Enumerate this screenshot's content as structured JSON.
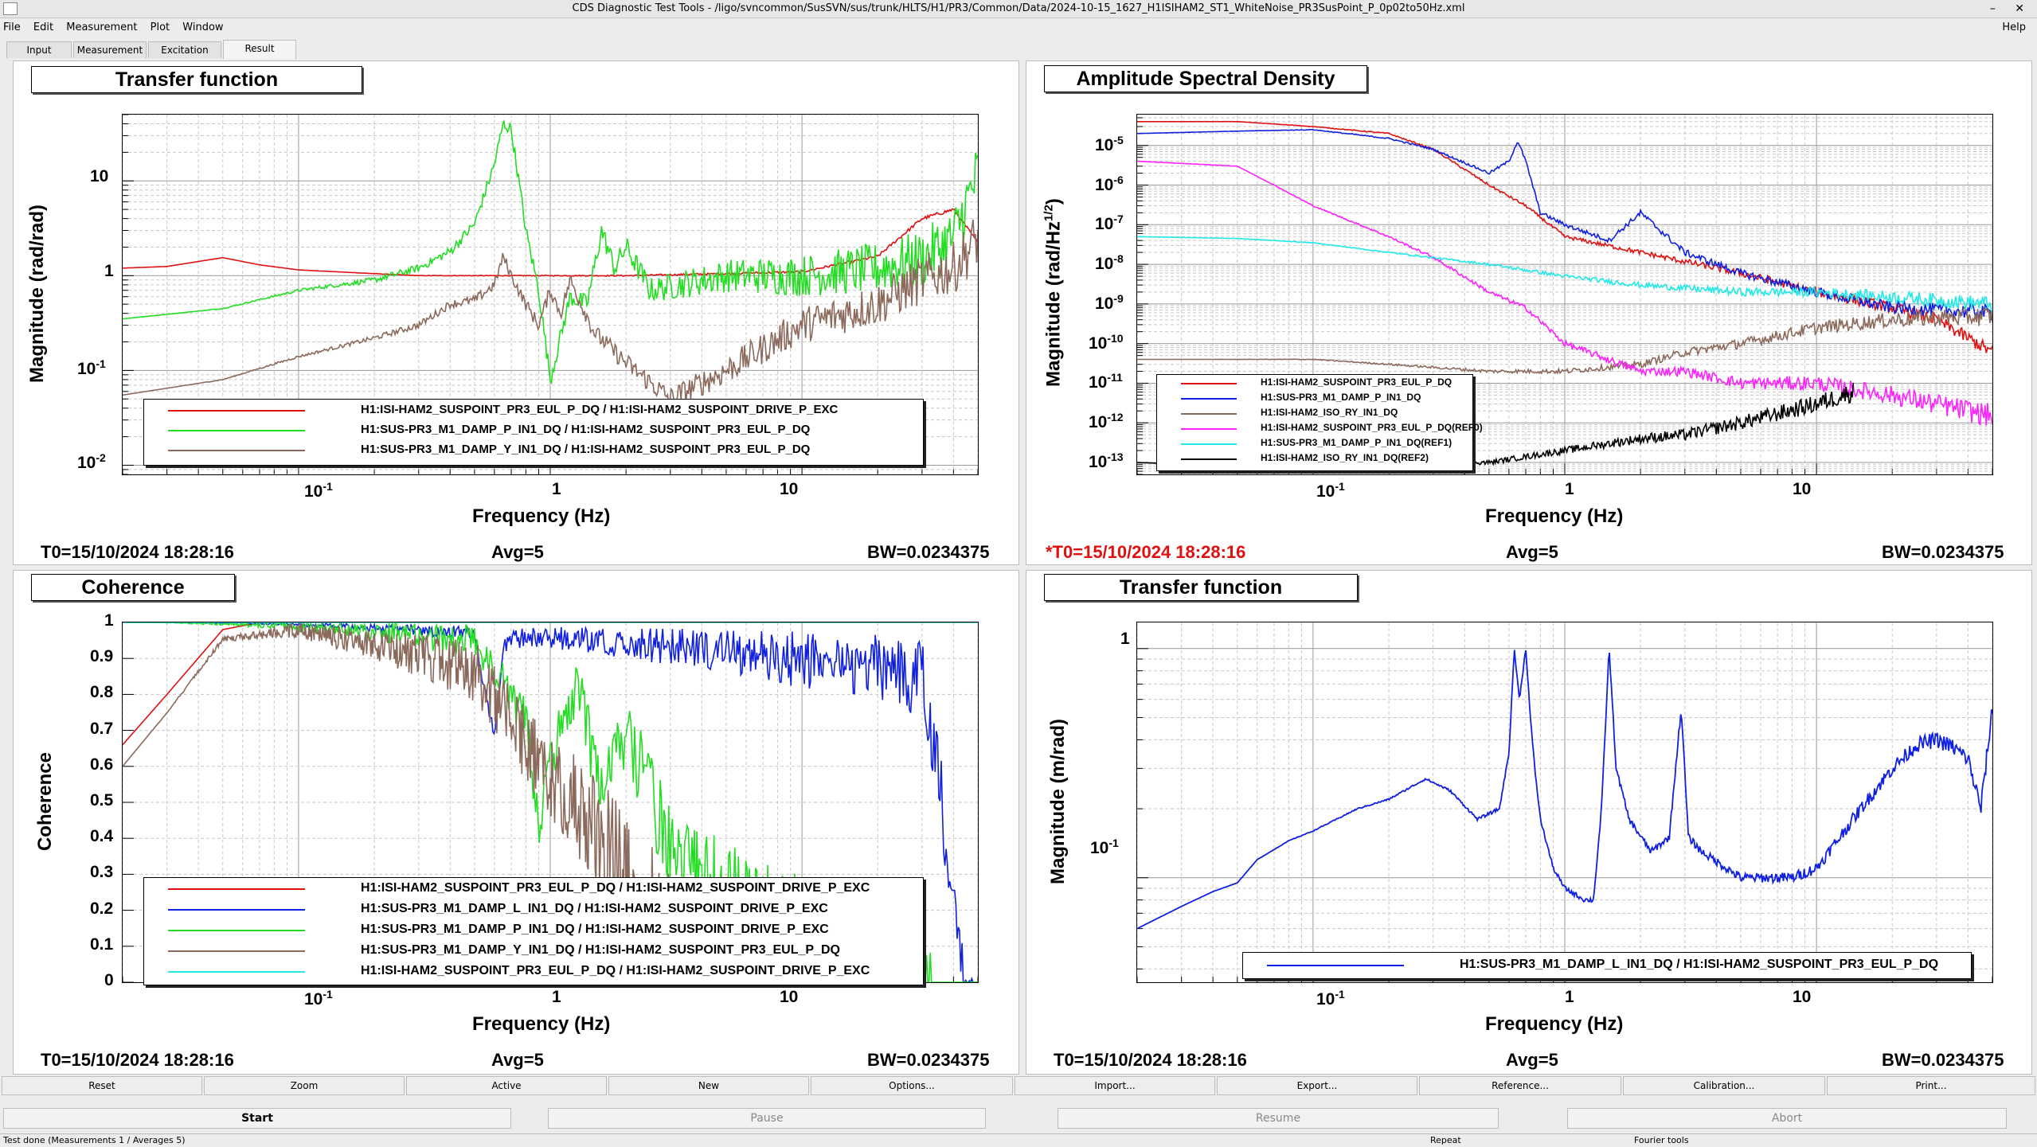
{
  "window": {
    "title": "CDS Diagnostic Test Tools - /ligo/svncommon/SusSVN/sus/trunk/HLTS/H1/PR3/Common/Data/2024-10-15_1627_H1ISIHAM2_ST1_WhiteNoise_PR3SusPoint_P_0p02to50Hz.xml",
    "controls": "– ✕"
  },
  "menu": {
    "file": "File",
    "edit": "Edit",
    "measurement": "Measurement",
    "plot": "Plot",
    "window": "Window",
    "help": "Help"
  },
  "tabs": [
    "Input",
    "Measurement",
    "Excitation",
    "Result"
  ],
  "panels": {
    "tl": {
      "title": "Transfer function",
      "ylabel": "Magnitude (rad/rad)",
      "xlabel": "Frequency (Hz)",
      "t0": "T0=15/10/2024 18:28:16",
      "avg": "Avg=5",
      "bw": "BW=0.0234375",
      "yticks": [
        "10",
        "1",
        "10",
        "10"
      ],
      "ytick_exp": [
        "",
        "",
        "-1",
        "-2"
      ],
      "legend": [
        {
          "label": "H1:ISI-HAM2_SUSPOINT_PR3_EUL_P_DQ / H1:ISI-HAM2_SUSPOINT_DRIVE_P_EXC",
          "color": "#e01010"
        },
        {
          "label": "H1:SUS-PR3_M1_DAMP_P_IN1_DQ / H1:ISI-HAM2_SUSPOINT_PR3_EUL_P_DQ",
          "color": "#22dd22"
        },
        {
          "label": "H1:SUS-PR3_M1_DAMP_Y_IN1_DQ / H1:ISI-HAM2_SUSPOINT_PR3_EUL_P_DQ",
          "color": "#8b6a5c"
        }
      ]
    },
    "tr": {
      "title": "Amplitude Spectral Density",
      "ylabel": "Magnitude (rad/Hz",
      "ylabel_sup": "1/2",
      "ylabel_end": ")",
      "xlabel": "Frequency (Hz)",
      "t0": "*T0=15/10/2024 18:28:16",
      "avg": "Avg=5",
      "bw": "BW=0.0234375",
      "ytick_exp": [
        "-5",
        "-6",
        "-7",
        "-8",
        "-9",
        "-10",
        "-11",
        "-12",
        "-13"
      ],
      "ytick_base": "10",
      "legend": [
        {
          "label": "H1:ISI-HAM2_SUSPOINT_PR3_EUL_P_DQ",
          "color": "#e01010"
        },
        {
          "label": "H1:SUS-PR3_M1_DAMP_P_IN1_DQ",
          "color": "#1020e0"
        },
        {
          "label": "H1:ISI-HAM2_ISO_RY_IN1_DQ",
          "color": "#8b6a5c"
        },
        {
          "label": "H1:ISI-HAM2_SUSPOINT_PR3_EUL_P_DQ(REF0)",
          "color": "#ff20ff"
        },
        {
          "label": "H1:SUS-PR3_M1_DAMP_P_IN1_DQ(REF1)",
          "color": "#22e8e8"
        },
        {
          "label": "H1:ISI-HAM2_ISO_RY_IN1_DQ(REF2)",
          "color": "#000000"
        }
      ]
    },
    "bl": {
      "title": "Coherence",
      "ylabel": "Coherence",
      "xlabel": "Frequency (Hz)",
      "t0": "T0=15/10/2024 18:28:16",
      "avg": "Avg=5",
      "bw": "BW=0.0234375",
      "yticks": [
        "1",
        "0.9",
        "0.8",
        "0.7",
        "0.6",
        "0.5",
        "0.4",
        "0.3",
        "0.2",
        "0.1",
        "0"
      ],
      "legend": [
        {
          "label": "H1:ISI-HAM2_SUSPOINT_PR3_EUL_P_DQ / H1:ISI-HAM2_SUSPOINT_DRIVE_P_EXC",
          "color": "#e01010"
        },
        {
          "label": "H1:SUS-PR3_M1_DAMP_L_IN1_DQ / H1:ISI-HAM2_SUSPOINT_DRIVE_P_EXC",
          "color": "#1020e0"
        },
        {
          "label": "H1:SUS-PR3_M1_DAMP_P_IN1_DQ / H1:ISI-HAM2_SUSPOINT_DRIVE_P_EXC",
          "color": "#22dd22"
        },
        {
          "label": "H1:SUS-PR3_M1_DAMP_Y_IN1_DQ / H1:ISI-HAM2_SUSPOINT_PR3_EUL_P_DQ",
          "color": "#8b6a5c"
        },
        {
          "label": "H1:ISI-HAM2_SUSPOINT_PR3_EUL_P_DQ / H1:ISI-HAM2_SUSPOINT_DRIVE_P_EXC",
          "color": "#22e8e8"
        }
      ]
    },
    "br": {
      "title": "Transfer function",
      "ylabel": "Magnitude (m/rad)",
      "xlabel": "Frequency (Hz)",
      "t0": "T0=15/10/2024 18:28:16",
      "avg": "Avg=5",
      "bw": "BW=0.0234375",
      "yticks": [
        "1",
        "10"
      ],
      "ytick_exp": [
        "",
        "-1"
      ],
      "legend": [
        {
          "label": "H1:SUS-PR3_M1_DAMP_L_IN1_DQ / H1:ISI-HAM2_SUSPOINT_PR3_EUL_P_DQ",
          "color": "#1020e0"
        }
      ]
    }
  },
  "xticks": {
    "base": "10",
    "exp": "-1",
    "one": "1",
    "ten": "10"
  },
  "toolbar1": [
    "Reset",
    "Zoom",
    "Active",
    "New",
    "Options...",
    "Import...",
    "Export...",
    "Reference...",
    "Calibration...",
    "Print..."
  ],
  "toolbar2": {
    "start": "Start",
    "pause": "Pause",
    "resume": "Resume",
    "abort": "Abort"
  },
  "status": {
    "left": "Test done (Measurements 1 / Averages 5)",
    "mid": "Repeat",
    "right": "Fourier tools"
  },
  "chart_data": [
    {
      "type": "line",
      "title": "Transfer function",
      "xlabel": "Frequency (Hz)",
      "ylabel": "Magnitude (rad/rad)",
      "xscale": "log",
      "yscale": "log",
      "xlim": [
        0.02,
        50
      ],
      "ylim": [
        0.008,
        50
      ],
      "grid": true,
      "legend": "bottom",
      "series": [
        {
          "name": "H1:ISI-HAM2_SUSPOINT_PR3_EUL_P_DQ / H1:ISI-HAM2_SUSPOINT_DRIVE_P_EXC",
          "color": "#e01010",
          "x": [
            0.02,
            0.03,
            0.05,
            0.07,
            0.1,
            0.2,
            0.3,
            0.5,
            1,
            2,
            5,
            10,
            20,
            30,
            40,
            50
          ],
          "y": [
            1.2,
            1.25,
            1.55,
            1.3,
            1.15,
            1.05,
            1.0,
            1.0,
            1.0,
            1.0,
            1.05,
            1.1,
            1.6,
            4.0,
            5.0,
            2.2
          ]
        },
        {
          "name": "H1:SUS-PR3_M1_DAMP_P_IN1_DQ / H1:ISI-HAM2_SUSPOINT_PR3_EUL_P_DQ",
          "color": "#22dd22",
          "x": [
            0.02,
            0.05,
            0.1,
            0.2,
            0.3,
            0.4,
            0.5,
            0.6,
            0.65,
            0.7,
            0.75,
            0.8,
            0.9,
            1.0,
            1.2,
            1.4,
            1.6,
            1.8,
            2.0,
            2.5,
            5,
            10,
            20,
            30,
            40,
            50
          ],
          "y": [
            0.35,
            0.45,
            0.7,
            0.9,
            1.2,
            1.8,
            3.5,
            15,
            40,
            35,
            10,
            3,
            0.7,
            0.08,
            0.6,
            0.5,
            3,
            1.2,
            2,
            0.7,
            1.0,
            1.0,
            1.2,
            1.5,
            2.5,
            12
          ]
        },
        {
          "name": "H1:SUS-PR3_M1_DAMP_Y_IN1_DQ / H1:ISI-HAM2_SUSPOINT_PR3_EUL_P_DQ",
          "color": "#8b6a5c",
          "x": [
            0.02,
            0.05,
            0.1,
            0.2,
            0.3,
            0.4,
            0.5,
            0.6,
            0.65,
            0.7,
            0.8,
            0.9,
            1.0,
            1.1,
            1.2,
            1.5,
            2,
            3,
            5,
            10,
            20,
            30,
            40,
            50
          ],
          "y": [
            0.055,
            0.08,
            0.14,
            0.22,
            0.3,
            0.5,
            0.55,
            0.8,
            1.6,
            1.0,
            0.5,
            0.3,
            0.7,
            0.4,
            0.9,
            0.25,
            0.12,
            0.05,
            0.1,
            0.3,
            0.5,
            0.9,
            1.2,
            2.5
          ]
        }
      ]
    },
    {
      "type": "line",
      "title": "Amplitude Spectral Density",
      "xlabel": "Frequency (Hz)",
      "ylabel": "Magnitude (rad/Hz^1/2)",
      "xscale": "log",
      "yscale": "log",
      "xlim": [
        0.02,
        50
      ],
      "ylim": [
        5e-14,
        6e-05
      ],
      "grid": true,
      "legend": "bottom-left",
      "series": [
        {
          "name": "H1:ISI-HAM2_SUSPOINT_PR3_EUL_P_DQ",
          "color": "#e01010",
          "x": [
            0.02,
            0.05,
            0.1,
            0.2,
            0.3,
            0.5,
            0.7,
            1,
            2,
            5,
            10,
            20,
            30,
            50
          ],
          "y": [
            4e-05,
            4e-05,
            3e-05,
            2e-05,
            8e-06,
            1e-06,
            3e-07,
            5e-08,
            2e-08,
            6e-09,
            2e-09,
            8e-10,
            4e-10,
            6e-11
          ]
        },
        {
          "name": "H1:SUS-PR3_M1_DAMP_P_IN1_DQ",
          "color": "#1020e0",
          "x": [
            0.02,
            0.05,
            0.1,
            0.2,
            0.3,
            0.5,
            0.6,
            0.65,
            0.7,
            0.8,
            1,
            1.5,
            2,
            3,
            5,
            10,
            20,
            50
          ],
          "y": [
            2e-05,
            2.3e-05,
            2.5e-05,
            1.5e-05,
            8e-06,
            2e-06,
            4e-06,
            1.3e-05,
            4e-06,
            2e-07,
            1e-07,
            4e-08,
            2e-07,
            2e-08,
            6e-09,
            2e-09,
            8e-10,
            6e-10
          ]
        },
        {
          "name": "H1:ISI-HAM2_ISO_RY_IN1_DQ",
          "color": "#8b6a5c",
          "x": [
            0.02,
            0.05,
            0.1,
            0.2,
            0.5,
            1,
            2,
            3,
            5,
            10,
            20,
            50
          ],
          "y": [
            4e-11,
            4e-11,
            4e-11,
            3e-11,
            2e-11,
            2e-11,
            3e-11,
            6e-11,
            1e-10,
            2.5e-10,
            4e-10,
            5e-10
          ]
        },
        {
          "name": "H1:ISI-HAM2_SUSPOINT_PR3_EUL_P_DQ(REF0)",
          "color": "#ff20ff",
          "x": [
            0.02,
            0.05,
            0.07,
            0.1,
            0.2,
            0.3,
            0.5,
            0.7,
            1,
            2,
            3,
            5,
            10,
            20,
            50
          ],
          "y": [
            4e-06,
            3e-06,
            1e-06,
            3e-07,
            5e-08,
            1.5e-08,
            2e-09,
            8e-10,
            1e-10,
            2e-11,
            2e-11,
            1e-11,
            1e-11,
            5e-12,
            1.5e-12
          ]
        },
        {
          "name": "H1:SUS-PR3_M1_DAMP_P_IN1_DQ(REF1)",
          "color": "#22e8e8",
          "x": [
            0.02,
            0.05,
            0.1,
            0.2,
            0.5,
            1,
            2,
            5,
            10,
            20,
            50
          ],
          "y": [
            5e-08,
            4.5e-08,
            3.5e-08,
            2e-08,
            1e-08,
            5e-09,
            3e-09,
            2e-09,
            2e-09,
            1.5e-09,
            1e-09
          ]
        },
        {
          "name": "H1:ISI-HAM2_ISO_RY_IN1_DQ(REF2)",
          "color": "#000000",
          "x": [
            0.02,
            0.05,
            0.1,
            0.2,
            0.5,
            1,
            2,
            3,
            5,
            10,
            14
          ],
          "y": [
            1e-13,
            8e-14,
            6e-14,
            1e-13,
            1e-13,
            2e-13,
            4e-13,
            5e-13,
            1e-12,
            3e-12,
            6e-12
          ]
        }
      ]
    },
    {
      "type": "line",
      "title": "Coherence",
      "xlabel": "Frequency (Hz)",
      "ylabel": "Coherence",
      "xscale": "log",
      "yscale": "linear",
      "xlim": [
        0.02,
        50
      ],
      "ylim": [
        0,
        1
      ],
      "grid": true,
      "legend": "bottom",
      "series": [
        {
          "name": "H1:ISI-HAM2_SUSPOINT_PR3_EUL_P_DQ / H1:ISI-HAM2_SUSPOINT_DRIVE_P_EXC",
          "color": "#e01010",
          "x": [
            0.02,
            0.03,
            0.05,
            0.07,
            0.1,
            1,
            10,
            50
          ],
          "y": [
            0.66,
            0.8,
            0.98,
            1.0,
            1.0,
            1.0,
            1.0,
            1.0
          ]
        },
        {
          "name": "H1:SUS-PR3_M1_DAMP_L_IN1_DQ / H1:ISI-HAM2_SUSPOINT_DRIVE_P_EXC",
          "color": "#1020e0",
          "x": [
            0.02,
            0.1,
            0.5,
            0.6,
            0.65,
            0.7,
            1,
            5,
            20,
            30,
            35,
            40,
            45,
            50
          ],
          "y": [
            1.0,
            1.0,
            0.99,
            0.7,
            0.95,
            0.98,
            0.99,
            0.98,
            0.97,
            0.95,
            0.7,
            0.3,
            0.05,
            0.02
          ]
        },
        {
          "name": "H1:SUS-PR3_M1_DAMP_P_IN1_DQ / H1:ISI-HAM2_SUSPOINT_DRIVE_P_EXC",
          "color": "#22dd22",
          "x": [
            0.02,
            0.1,
            0.5,
            0.8,
            0.9,
            1,
            1.3,
            1.6,
            2,
            3,
            5,
            10,
            20,
            30,
            50
          ],
          "y": [
            1.0,
            1.0,
            1.0,
            0.8,
            0.5,
            0.7,
            0.9,
            0.6,
            0.8,
            0.5,
            0.4,
            0.3,
            0.2,
            0.1,
            0.02
          ]
        },
        {
          "name": "H1:SUS-PR3_M1_DAMP_Y_IN1_DQ / H1:ISI-HAM2_SUSPOINT_PR3_EUL_P_DQ",
          "color": "#8b6a5c",
          "x": [
            0.02,
            0.03,
            0.05,
            0.1,
            0.5,
            1,
            2,
            3,
            5
          ],
          "y": [
            0.6,
            0.75,
            0.96,
            1.0,
            0.95,
            0.7,
            0.5,
            0.3,
            0.1
          ]
        },
        {
          "name": "H1:ISI-HAM2_SUSPOINT_PR3_EUL_P_DQ / H1:ISI-HAM2_SUSPOINT_DRIVE_P_EXC",
          "color": "#22e8e8",
          "x": [
            0.02,
            0.1,
            1,
            10,
            50
          ],
          "y": [
            1.0,
            1.0,
            1.0,
            1.0,
            1.0
          ]
        }
      ]
    },
    {
      "type": "line",
      "title": "Transfer function",
      "xlabel": "Frequency (Hz)",
      "ylabel": "Magnitude (m/rad)",
      "xscale": "log",
      "yscale": "log",
      "xlim": [
        0.02,
        50
      ],
      "ylim": [
        0.035,
        1.3
      ],
      "grid": true,
      "legend": "bottom-right",
      "series": [
        {
          "name": "H1:SUS-PR3_M1_DAMP_L_IN1_DQ / H1:ISI-HAM2_SUSPOINT_PR3_EUL_P_DQ",
          "color": "#1020e0",
          "x": [
            0.02,
            0.03,
            0.04,
            0.05,
            0.06,
            0.08,
            0.1,
            0.15,
            0.2,
            0.28,
            0.35,
            0.45,
            0.55,
            0.6,
            0.63,
            0.66,
            0.7,
            0.73,
            0.76,
            0.8,
            0.9,
            1.0,
            1.2,
            1.3,
            1.4,
            1.5,
            1.6,
            1.8,
            2.2,
            2.6,
            2.9,
            3.1,
            3.5,
            5,
            8,
            10,
            15,
            20,
            25,
            30,
            35,
            40,
            45,
            50
          ],
          "y": [
            0.06,
            0.075,
            0.087,
            0.095,
            0.12,
            0.145,
            0.16,
            0.2,
            0.22,
            0.27,
            0.24,
            0.18,
            0.2,
            0.35,
            1.0,
            0.6,
            1.0,
            0.5,
            0.3,
            0.18,
            0.11,
            0.09,
            0.08,
            0.08,
            0.2,
            1.0,
            0.3,
            0.18,
            0.13,
            0.15,
            0.55,
            0.15,
            0.13,
            0.1,
            0.1,
            0.11,
            0.2,
            0.3,
            0.38,
            0.4,
            0.37,
            0.33,
            0.2,
            0.55
          ]
        }
      ]
    }
  ]
}
